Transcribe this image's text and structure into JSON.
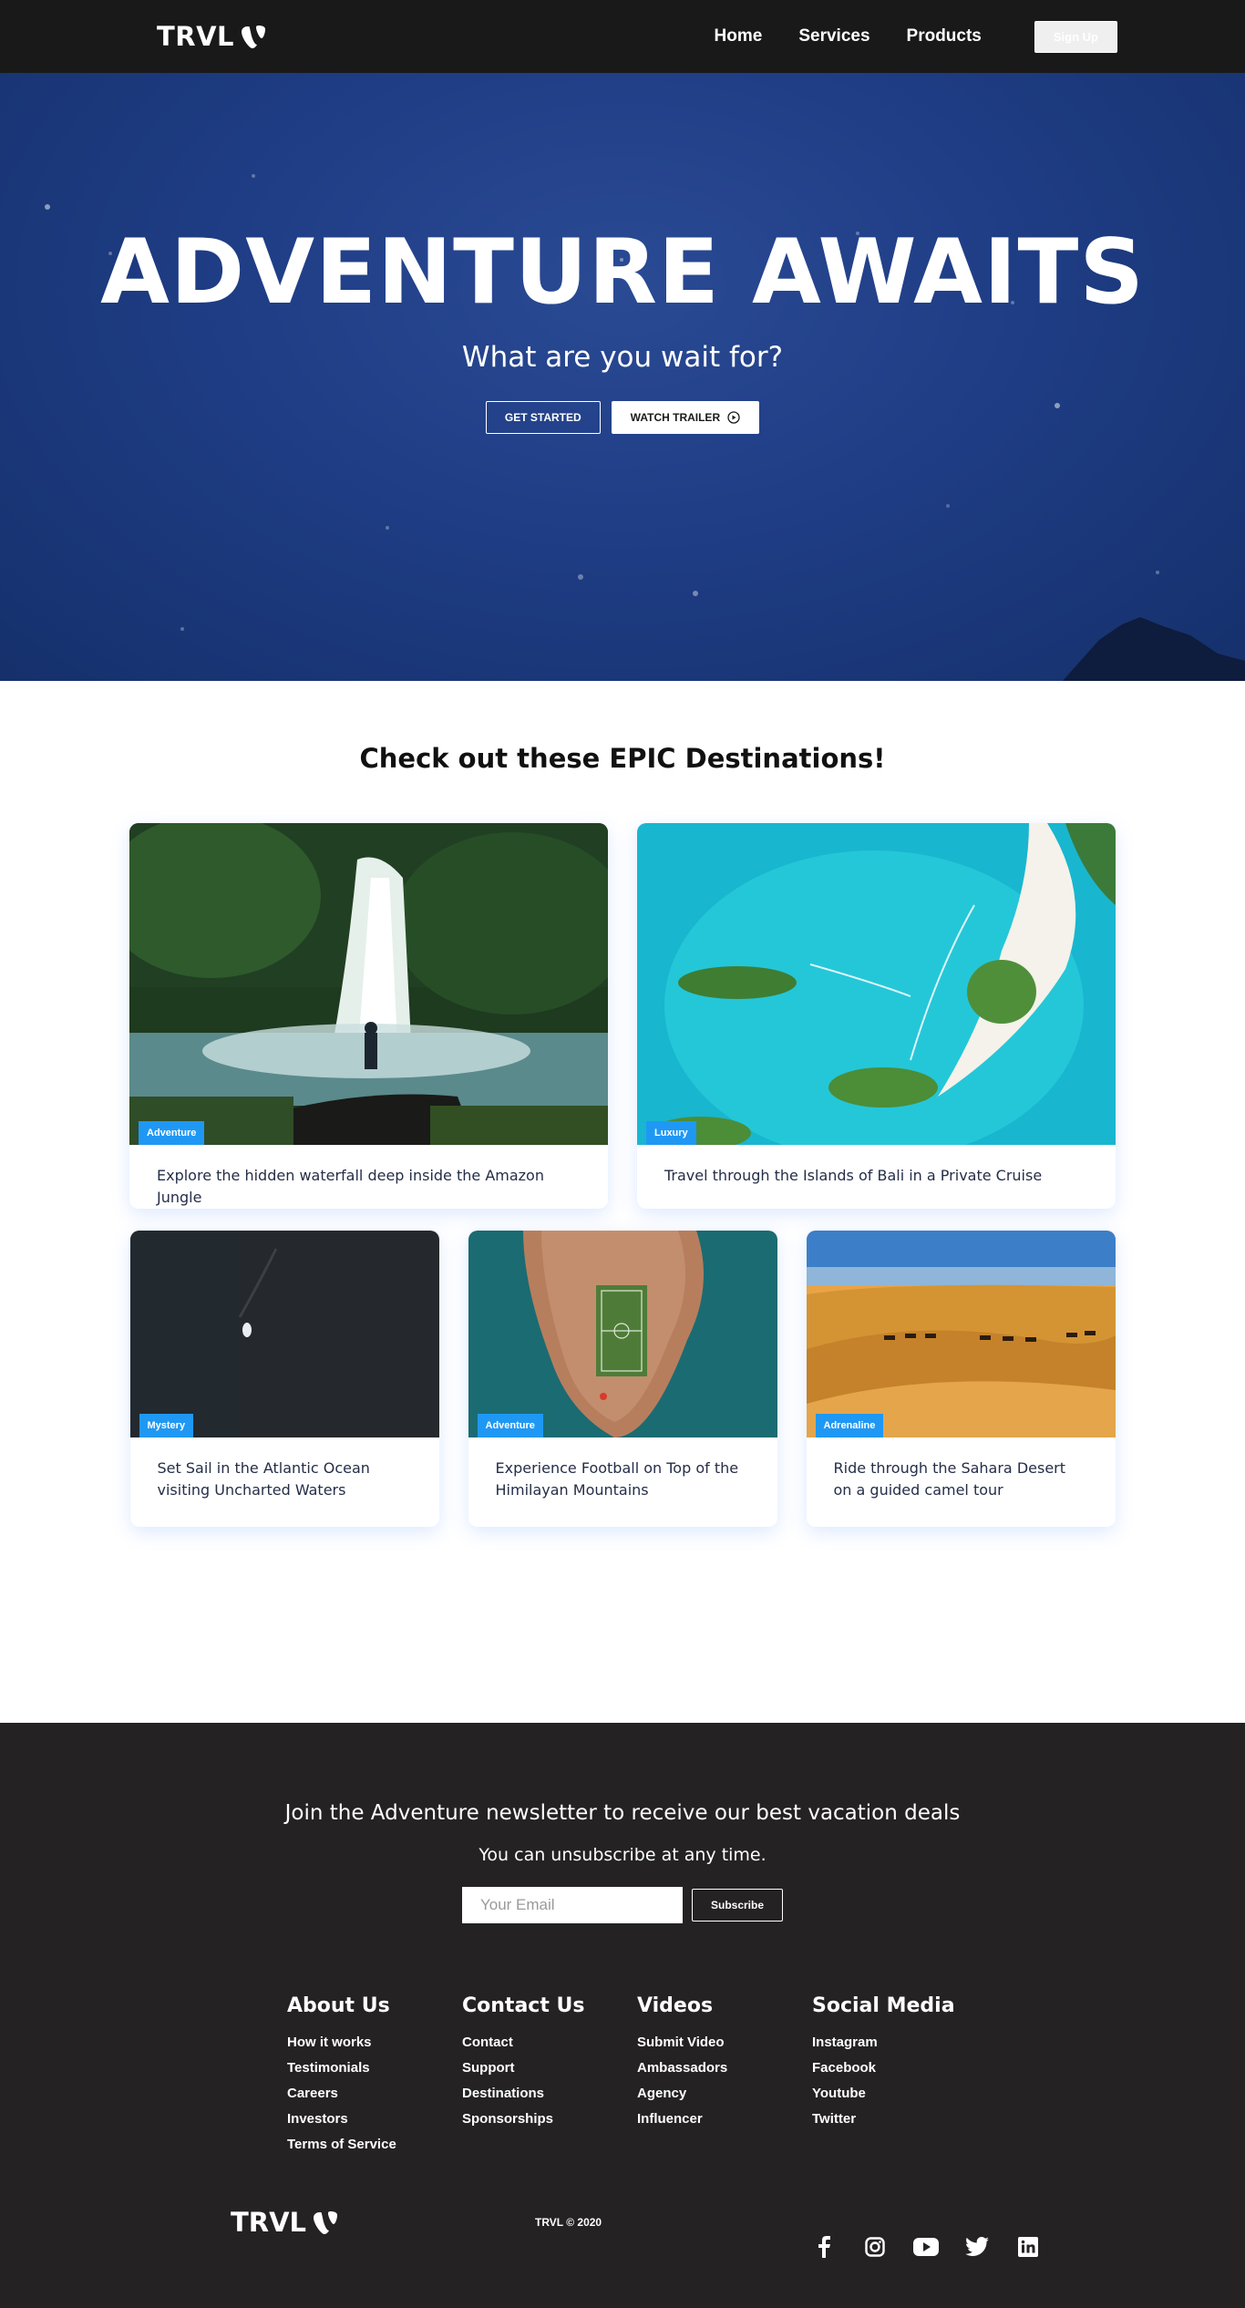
{
  "navbar": {
    "logo_text": "TRVL",
    "links": [
      "Home",
      "Services",
      "Products"
    ],
    "signup_label": "Sign Up"
  },
  "hero": {
    "title": "ADVENTURE AWAITS",
    "subtitle": "What are you wait for?",
    "get_started_label": "GET STARTED",
    "watch_trailer_label": "WATCH TRAILER",
    "watch_icon": "play-circle-icon"
  },
  "destinations": {
    "title": "Check out these EPIC Destinations!",
    "cards": [
      {
        "badge": "Adventure",
        "text": "Explore the hidden waterfall deep inside the Amazon Jungle"
      },
      {
        "badge": "Luxury",
        "text": "Travel through the Islands of Bali in a Private Cruise"
      },
      {
        "badge": "Mystery",
        "text": "Set Sail in the Atlantic Ocean visiting Uncharted Waters"
      },
      {
        "badge": "Adventure",
        "text": "Experience Football on Top of the Himilayan Mountains"
      },
      {
        "badge": "Adrenaline",
        "text": "Ride through the Sahara Desert on a guided camel tour"
      }
    ],
    "badge_color": "#1f98f4"
  },
  "newsletter": {
    "heading": "Join the Adventure newsletter to receive our best vacation deals",
    "subheading": "You can unsubscribe at any time.",
    "email_placeholder": "Your Email",
    "subscribe_label": "Subscribe"
  },
  "footer": {
    "columns": [
      {
        "title": "About Us",
        "links": [
          "How it works",
          "Testimonials",
          "Careers",
          "Investors",
          "Terms of Service"
        ]
      },
      {
        "title": "Contact Us",
        "links": [
          "Contact",
          "Support",
          "Destinations",
          "Sponsorships"
        ]
      },
      {
        "title": "Videos",
        "links": [
          "Submit Video",
          "Ambassadors",
          "Agency",
          "Influencer"
        ]
      },
      {
        "title": "Social Media",
        "links": [
          "Instagram",
          "Facebook",
          "Youtube",
          "Twitter"
        ]
      }
    ],
    "logo_text": "TRVL",
    "copyright": "TRVL © 2020",
    "social_icons": [
      "facebook-icon",
      "instagram-icon",
      "youtube-icon",
      "twitter-icon",
      "linkedin-icon"
    ]
  },
  "colors": {
    "navbar_bg": "#1a1919",
    "hero_bg": "#1f3d85",
    "footer_bg": "#242222",
    "accent": "#1f98f4"
  }
}
